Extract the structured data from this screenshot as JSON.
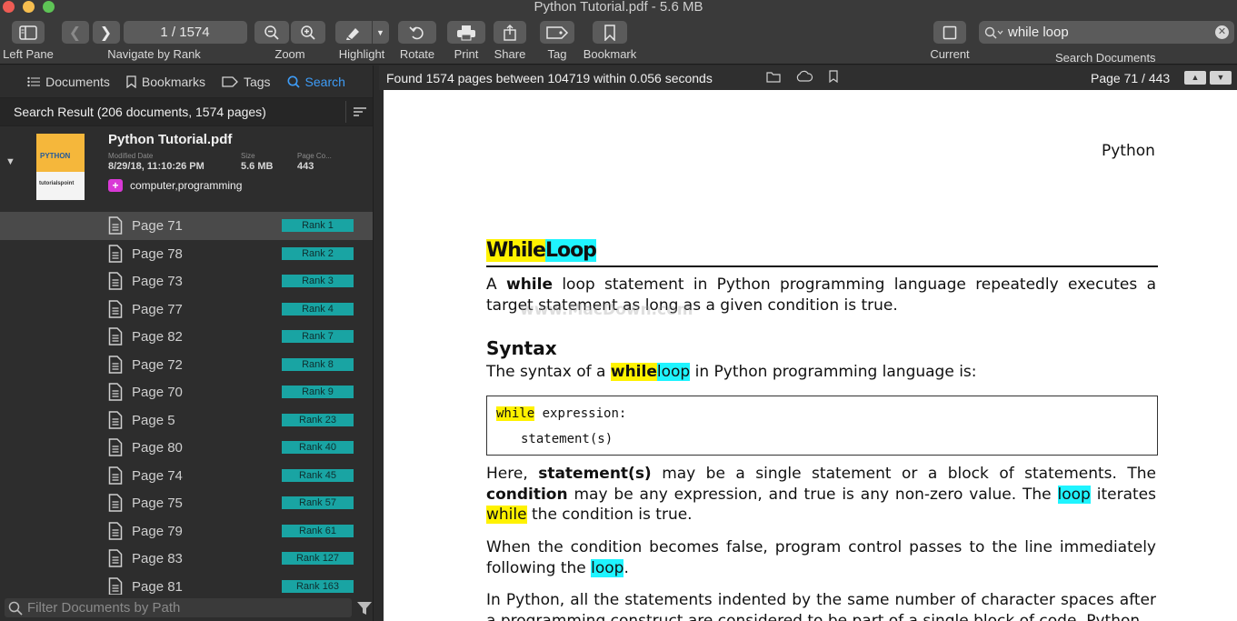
{
  "window": {
    "title": "Python Tutorial.pdf - 5.6 MB"
  },
  "toolbar": {
    "left_pane": "Left Pane",
    "page_counter": "1 / 1574",
    "navigate_label": "Navigate by Rank",
    "zoom_label": "Zoom",
    "highlight_label": "Highlight",
    "rotate_label": "Rotate",
    "print_label": "Print",
    "share_label": "Share",
    "tag_label": "Tag",
    "bookmark_label": "Bookmark",
    "current_label": "Current",
    "search_value": "while loop",
    "search_label": "Search Documents"
  },
  "sidebar": {
    "tabs": [
      {
        "label": "Documents"
      },
      {
        "label": "Bookmarks"
      },
      {
        "label": "Tags"
      },
      {
        "label": "Search"
      }
    ],
    "active_tab": "Search",
    "result_header": "Search Result (206 documents, 1574 pages)",
    "document": {
      "name": "Python Tutorial.pdf",
      "modified_key": "Modified Date",
      "modified": "8/29/18, 11:10:26 PM",
      "size_key": "Size",
      "size": "5.6 MB",
      "pages_key": "Page Co...",
      "pages": "443",
      "tags": "computer,programming",
      "thumb_title": "PYTHON",
      "thumb_brand": "tutorialspoint"
    },
    "pages": [
      {
        "label": "Page 71",
        "rank": "Rank 1"
      },
      {
        "label": "Page 78",
        "rank": "Rank 2"
      },
      {
        "label": "Page 73",
        "rank": "Rank 3"
      },
      {
        "label": "Page 77",
        "rank": "Rank 4"
      },
      {
        "label": "Page 82",
        "rank": "Rank 7"
      },
      {
        "label": "Page 72",
        "rank": "Rank 8"
      },
      {
        "label": "Page 70",
        "rank": "Rank 9"
      },
      {
        "label": "Page 5",
        "rank": "Rank 23"
      },
      {
        "label": "Page 80",
        "rank": "Rank 40"
      },
      {
        "label": "Page 74",
        "rank": "Rank 45"
      },
      {
        "label": "Page 75",
        "rank": "Rank 57"
      },
      {
        "label": "Page 79",
        "rank": "Rank 61"
      },
      {
        "label": "Page 83",
        "rank": "Rank 127"
      },
      {
        "label": "Page 81",
        "rank": "Rank 163"
      }
    ],
    "filter_placeholder": "Filter Documents by Path"
  },
  "viewer": {
    "found_text": "Found 1574 pages between 104719 within 0.056 seconds",
    "page_position": "Page 71 / 443"
  },
  "pdf": {
    "running_head": "Python",
    "heading_w1": "While",
    "heading_w2": "Loop",
    "p1_a": "A",
    "p1_b": "while",
    "p1_c": "loop statement in Python programming language repeatedly executes a target statement as long as a given condition is true.",
    "syntax_title": "Syntax",
    "p2_a": "The syntax of a",
    "p2_b": "while",
    "p2_c": "loop",
    "p2_d": "in Python programming language is:",
    "code_kw": "while",
    "code_l1_rest": " expression:",
    "code_l2": "statement(s)",
    "p3_a": "Here,",
    "p3_b": "statement(s)",
    "p3_c": "may be a single statement or a block of statements. The",
    "p3_d": "condition",
    "p3_e": "may be any expression, and true is any non-zero value. The",
    "p3_f": "loop",
    "p3_g": "iterates",
    "p3_h": "while",
    "p3_i": "the condition is true.",
    "p4_a": "When the condition becomes false, program control passes to the line immediately following the",
    "p4_b": "loop",
    "p4_c": ".",
    "p5": "In Python, all the statements indented by the same number of character spaces after a programming construct are considered to be part of a single block of code. Python",
    "watermark": "www.MacDown.com"
  },
  "colors": {
    "highlight_yellow": "#fff200",
    "highlight_cyan": "#1ff4ff",
    "rank_badge": "#19a4a3",
    "accent_blue": "#3e9cf6",
    "tag_magenta": "#d939d6"
  }
}
